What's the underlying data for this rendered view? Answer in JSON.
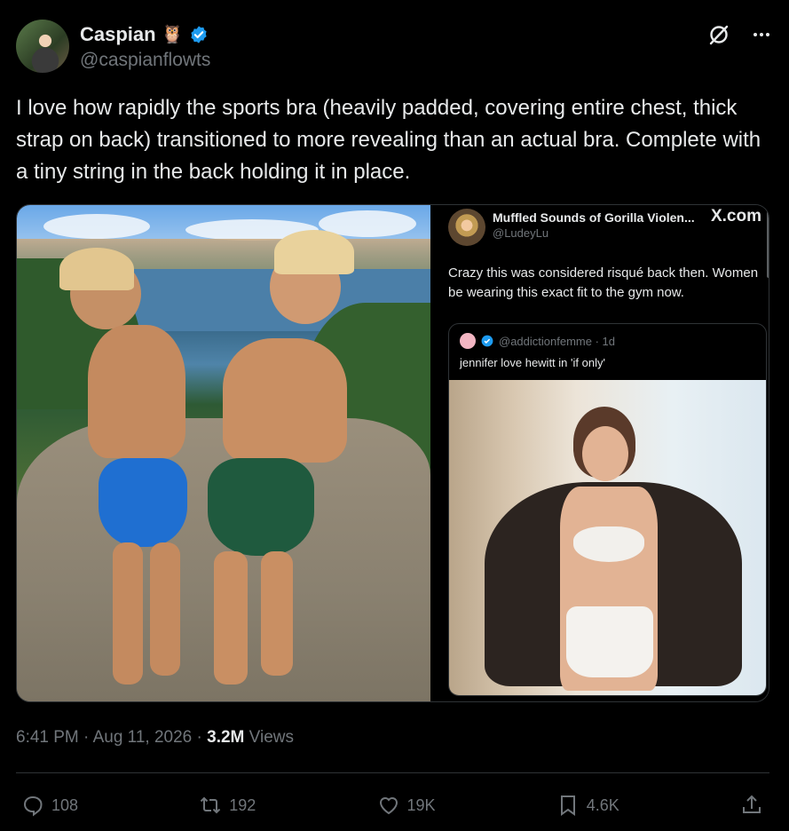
{
  "author": {
    "name": "Caspian",
    "emoji": "🦉",
    "handle": "@caspianflowts"
  },
  "tweet": {
    "text": "I love how rapidly the sports bra (heavily padded, covering entire chest, thick strap on back) transitioned to more revealing than an actual bra. Complete with a tiny string in the back holding it in place."
  },
  "quoted": {
    "name": "Muffled Sounds of Gorilla Violen...",
    "handle": "@LudeyLu",
    "source": "X.com",
    "text": "Crazy this was considered risqué back then. Women be wearing this exact fit to the gym now.",
    "inner": {
      "handle": "@addictionfemme · 1d",
      "text": "jennifer love hewitt in 'if only'"
    }
  },
  "meta": {
    "time": "6:41 PM · Aug 11, 2026 · ",
    "views_count": "3.2M",
    "views_label": " Views"
  },
  "actions": {
    "replies": "108",
    "reposts": "192",
    "likes": "19K",
    "bookmarks": "4.6K"
  },
  "colors": {
    "background": "#000000",
    "text_primary": "#e7e9ea",
    "text_secondary": "#71767b",
    "verified": "#1d9bf0"
  }
}
